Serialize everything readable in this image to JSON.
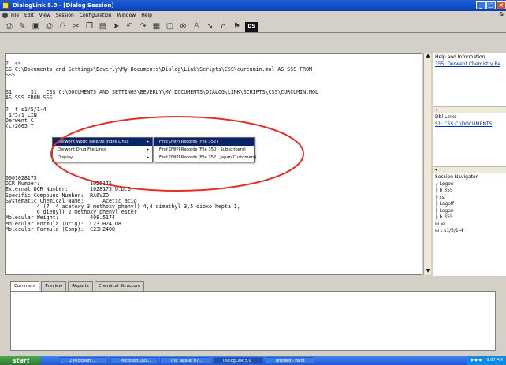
{
  "window": {
    "title": "DialogLink 5.0 - [Dialog Session]",
    "controls": [
      "_",
      "□",
      "×"
    ]
  },
  "menubar": {
    "items": [
      "File",
      "Edit",
      "View",
      "Session",
      "Configuration",
      "Window",
      "Help"
    ],
    "mdi_controls": "_ &"
  },
  "toolbar": {
    "icons": [
      "print-preview-icon",
      "edit-icon",
      "save-icon",
      "print-icon",
      "binoculars-icon",
      "cut-icon",
      "copy-icon",
      "paste-icon",
      "send-icon",
      "undo-icon",
      "redo-icon",
      "table-icon",
      "window-icon",
      "stop-icon",
      "user-icon",
      "pointer-icon",
      "home-icon",
      "flag-icon"
    ],
    "ds_label": "DS"
  },
  "session": {
    "lines_top": "?  ss\nSS C:\\Documents and Settings\\Beverly\\My Documents\\Dialog\\Link\\Scripts\\CSS\\curcumin.mol AS SSS FROM\nSSS\n\n\nS1      S1   CSS C:\\DOCUMENTS AND SETTINGS\\BEVERLY\\MY DOCUMENTS\\DIALOG\\LINK\\SCRIPTS\\CSS\\CURCUMIN.MOL\nAS SSS FROM SSS\n\n?  t s1/5/1-4\n 1/5/1 LIN\nDerwent C\n(c)2005 T",
    "lines_bottom": "0001028175\nDCR Number:                1028175\nExternal DCR Number:       1028175 U.D.B.\nSpecific Compound Number:  RA6VZO\nSystematic Chemical Name:      Acetic acid\n          4 (7 (4 acetoxy 3 methoxy phenyl) 4,4 dimethyl 3,5 dioxo hepta 1,\n          6 dienyl) 2 methoxy phenyl ester\nMolecular Weight:          408.5174\nMolecular Formula (Orig):  C23 H24 O8\nMolecular Formula (Comp):  C23H24O8"
  },
  "context_menu": {
    "items": [
      {
        "label": "Derwent World Patents Index Links",
        "selected": true
      },
      {
        "label": "Derwent Drug File Links",
        "selected": false
      },
      {
        "label": "Display",
        "selected": false
      }
    ],
    "submenu": [
      {
        "label": "Find DWPI Records (File 352)",
        "selected": true
      },
      {
        "label": "Find DWPI Records (File 350 - Subscribers)",
        "selected": false
      },
      {
        "label": "Find DWPI Records (File 352 - Japan Customers)",
        "selected": false
      }
    ]
  },
  "right_panel": {
    "help_header": "Help and Information",
    "help_link": "355: Derwent Chemistry Re",
    "links_header": "Dbl Links",
    "links_item": "S1: CSS C:\\DOCUMENTS",
    "session_nav_header": "Session Navigator",
    "tree": [
      "Logon",
      "b 355",
      "ss",
      "Logoff",
      "Logon",
      "b 355",
      "ss",
      "t s1/5/1-4"
    ]
  },
  "tabs": [
    "Comment",
    "Preview",
    "Reports",
    "Chemical Structure"
  ],
  "taskbar": {
    "start_label": "start",
    "tasks": [
      {
        "label": "2 Microsoft ...",
        "active": false
      },
      {
        "label": "Microsoft Out...",
        "active": false
      },
      {
        "label": "The Tackler 07...",
        "active": false
      },
      {
        "label": "DialogLink 5.0",
        "active": true
      },
      {
        "label": "untitled - Paint",
        "active": false
      }
    ],
    "clock": "9:07 AM"
  }
}
